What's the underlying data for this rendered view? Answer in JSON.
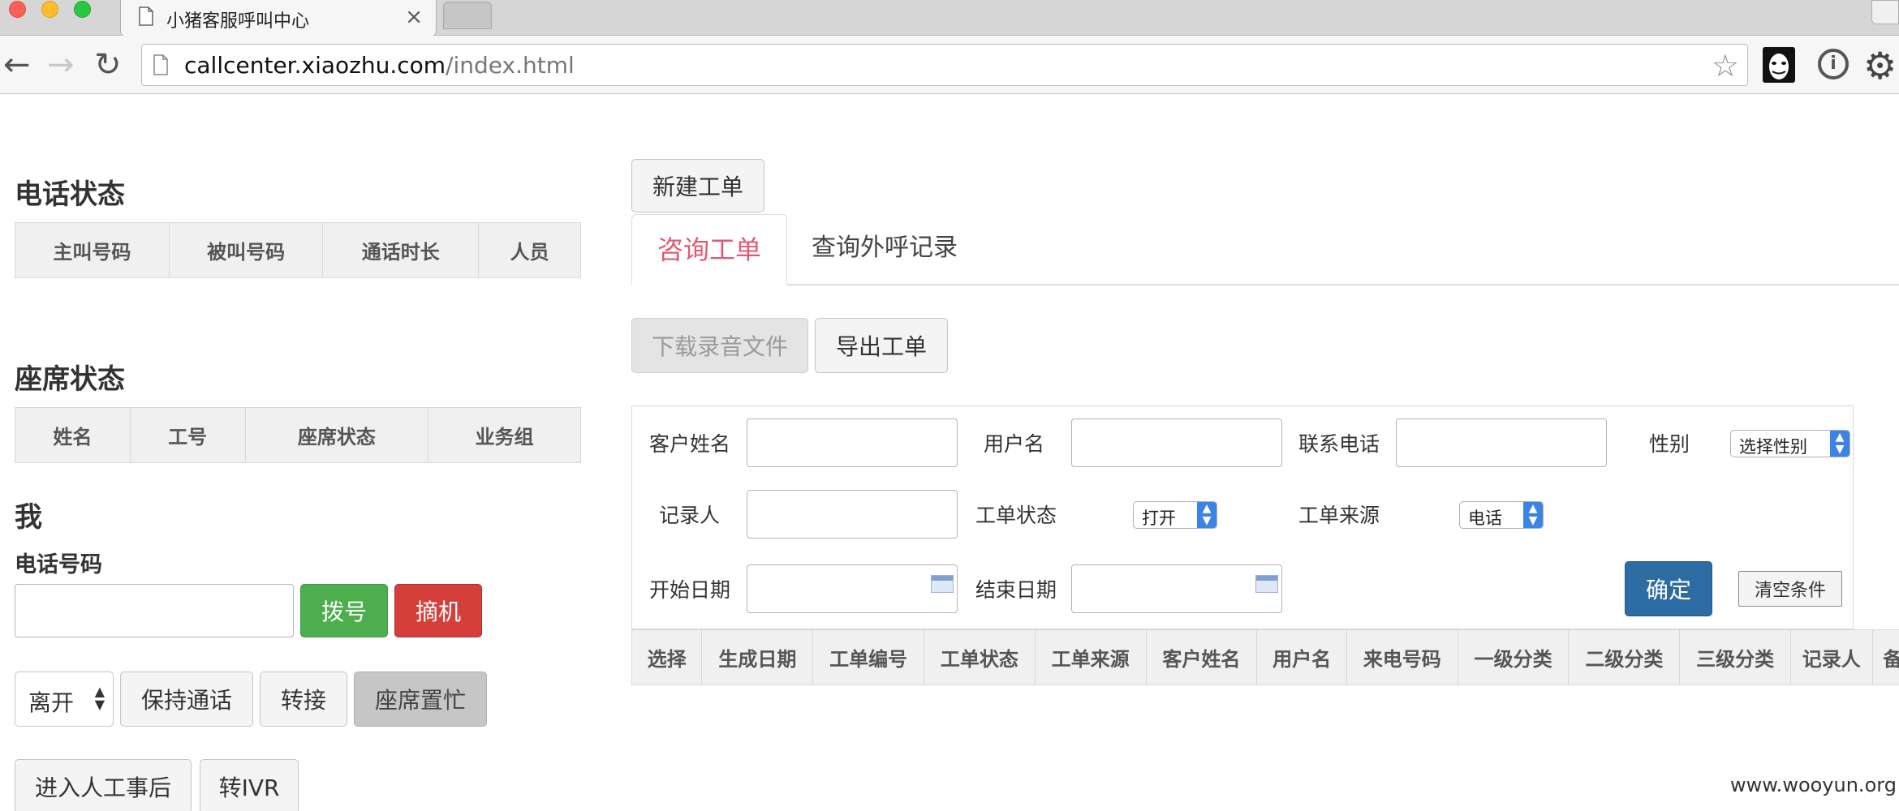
{
  "browser": {
    "tab_title": "小猪客服呼叫中心",
    "tab_close": "×",
    "url_host": "callcenter.xiaozhu.com",
    "url_path": "/index.html",
    "star": "☆",
    "info": "i",
    "gear": "⚙",
    "back": "←",
    "forward": "→",
    "reload": "↻"
  },
  "phone_status": {
    "title": "电话状态",
    "columns": [
      "主叫号码",
      "被叫号码",
      "通话时长",
      "人员"
    ]
  },
  "seat_status": {
    "title": "座席状态",
    "columns": [
      "姓名",
      "工号",
      "座席状态",
      "业务组"
    ]
  },
  "me": {
    "title": "我",
    "phone_label": "电话号码",
    "phone_value": "",
    "dial_button": "拨号",
    "hangup_button": "摘机",
    "status_select": "离开",
    "hold_button": "保持通话",
    "transfer_button": "转接",
    "busy_button": "座席置忙",
    "after_call_button": "进入人工事后",
    "ivr_button": "转IVR"
  },
  "workorder": {
    "new_button": "新建工单",
    "tabs": [
      "咨询工单",
      "查询外呼记录"
    ],
    "download_button": "下载录音文件",
    "export_button": "导出工单",
    "filters": {
      "customer_name": "客户姓名",
      "username": "用户名",
      "contact_phone": "联系电话",
      "gender": "性别",
      "gender_select": "选择性别",
      "recorder": "记录人",
      "order_status": "工单状态",
      "order_status_select": "打开",
      "order_source": "工单来源",
      "order_source_select": "电话",
      "start_date": "开始日期",
      "end_date": "结束日期",
      "confirm_button": "确定",
      "clear_button": "清空条件"
    },
    "table_columns": [
      "选择",
      "生成日期",
      "工单编号",
      "工单状态",
      "工单来源",
      "客户姓名",
      "用户名",
      "来电号码",
      "一级分类",
      "二级分类",
      "三级分类",
      "记录人",
      "备"
    ]
  },
  "watermark": "www.wooyun.org"
}
